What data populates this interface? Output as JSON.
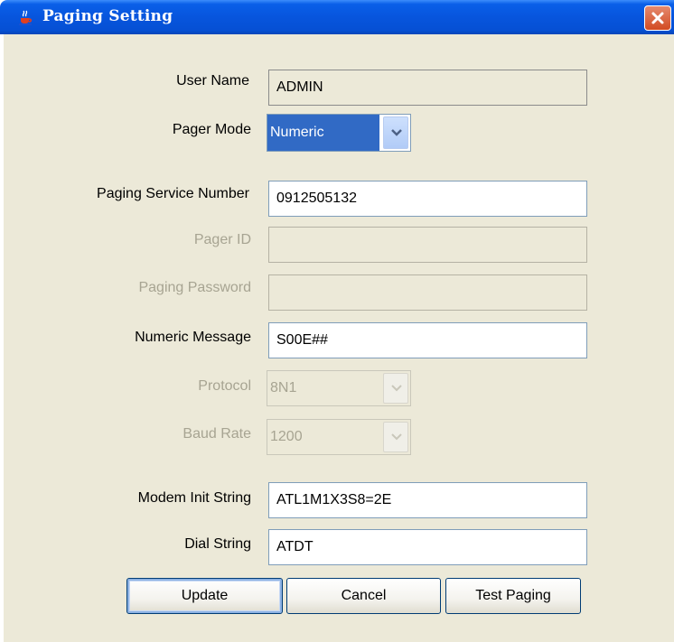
{
  "window": {
    "title": "Paging Setting",
    "icon": "java-cup-icon",
    "close_icon": "close-icon"
  },
  "form": {
    "user_name": {
      "label": "User Name",
      "value": "ADMIN"
    },
    "pager_mode": {
      "label": "Pager Mode",
      "value": "Numeric"
    },
    "paging_service_number": {
      "label": "Paging Service Number",
      "value": "0912505132"
    },
    "pager_id": {
      "label": "Pager ID",
      "value": ""
    },
    "paging_password": {
      "label": "Paging Password",
      "value": ""
    },
    "numeric_message": {
      "label": "Numeric Message",
      "value": "S00E##"
    },
    "protocol": {
      "label": "Protocol",
      "value": "8N1"
    },
    "baud_rate": {
      "label": "Baud Rate",
      "value": "1200"
    },
    "modem_init_string": {
      "label": "Modem Init String",
      "value": "ATL1M1X3S8=2E"
    },
    "dial_string": {
      "label": "Dial String",
      "value": "ATDT"
    }
  },
  "buttons": {
    "update": "Update",
    "cancel": "Cancel",
    "test_paging": "Test Paging"
  },
  "colors": {
    "titlebar": "#0755dd",
    "dialog_bg": "#ece9d8",
    "selection": "#316ac5",
    "disabled_text": "#a7a492"
  }
}
